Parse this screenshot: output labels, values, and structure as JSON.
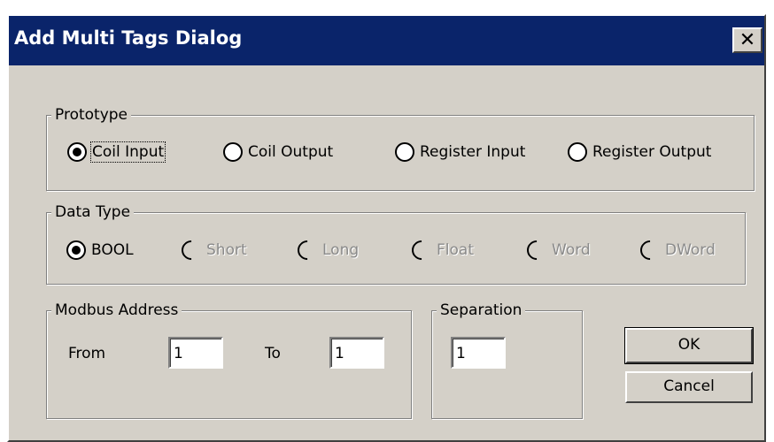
{
  "window": {
    "title": "Add Multi Tags Dialog",
    "close_label": "✕"
  },
  "prototype": {
    "legend": "Prototype",
    "options": [
      "Coil Input",
      "Coil Output",
      "Register Input",
      "Register Output"
    ],
    "selected": "Coil Input"
  },
  "data_type": {
    "legend": "Data Type",
    "options": [
      "BOOL",
      "Short",
      "Long",
      "Float",
      "Word",
      "DWord"
    ],
    "selected": "BOOL"
  },
  "modbus_address": {
    "legend": "Modbus Address",
    "from_label": "From",
    "from_value": "1",
    "to_label": "To",
    "to_value": "1"
  },
  "separation": {
    "legend": "Separation",
    "value": "1"
  },
  "buttons": {
    "ok": "OK",
    "cancel": "Cancel"
  }
}
